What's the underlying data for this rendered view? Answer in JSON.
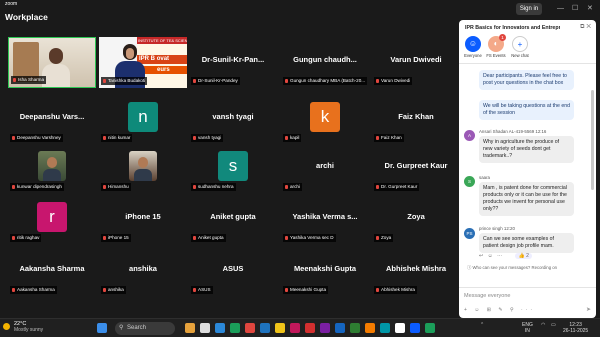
{
  "topbar": {
    "logo_small": "zoom",
    "logo_big": "Workplace",
    "signin": "Sign in",
    "minimize": "—",
    "maximize": "☐",
    "close": "✕"
  },
  "tiles": [
    {
      "name": "",
      "label": "Isha Sharma",
      "type": "video"
    },
    {
      "name": "",
      "label": "Tanishka Budakoti",
      "type": "video"
    },
    {
      "name": "Dr-Sunil-Kr-Pan...",
      "label": "Dr-Sunil-Kr-Pandey",
      "type": "text"
    },
    {
      "name": "Gungun  chaudh...",
      "label": "Gungun chaudhary MBA (Batch-20...",
      "type": "text"
    },
    {
      "name": "Varun Dwivedi",
      "label": "Varun Dwivedi",
      "type": "text"
    },
    {
      "name": "Deepanshu  Vars...",
      "label": "Deepanshu Varshney",
      "type": "text"
    },
    {
      "name": "",
      "label": "nitin kumar",
      "type": "avatar",
      "letter": "n",
      "color": "#0e8a7a"
    },
    {
      "name": "vansh tyagi",
      "label": "vansh tyagi",
      "type": "text"
    },
    {
      "name": "",
      "label": "kapil",
      "type": "avatar",
      "letter": "k",
      "color": "#e8711d"
    },
    {
      "name": "Faiz Khan",
      "label": "Faiz Khan",
      "type": "text"
    },
    {
      "name": "",
      "label": "kunwar dipendrasingh",
      "type": "photo"
    },
    {
      "name": "",
      "label": "Himanshu",
      "type": "photo2"
    },
    {
      "name": "",
      "label": "sudhanshu nehra",
      "type": "avatar",
      "letter": "s",
      "color": "#11897c"
    },
    {
      "name": "archi",
      "label": "archi",
      "type": "text"
    },
    {
      "name": "Dr. Gurpreet Kaur",
      "label": "Dr. Gurpreet Kaur",
      "type": "text"
    },
    {
      "name": "",
      "label": "ritik raghav",
      "type": "avatar",
      "letter": "r",
      "color": "#c8166e"
    },
    {
      "name": "iPhone 15",
      "label": "iPhone 15",
      "type": "text"
    },
    {
      "name": "Aniket gupta",
      "label": "Aniket gupta",
      "type": "text"
    },
    {
      "name": "Yashika  Verma  s...",
      "label": "Yashika Verma sec D",
      "type": "text"
    },
    {
      "name": "Zoya",
      "label": "Zoya",
      "type": "text"
    },
    {
      "name": "Aakansha Sharma",
      "label": "Aakansha Sharma",
      "type": "text"
    },
    {
      "name": "anshika",
      "label": "anshika",
      "type": "text"
    },
    {
      "name": "ASUS",
      "label": "ASUS",
      "type": "text"
    },
    {
      "name": "Meenakshi Gupta",
      "label": "Meenakshi Gupta",
      "type": "text"
    },
    {
      "name": "Abhishek Mishra",
      "label": "Abhishek Mishra",
      "type": "text"
    }
  ],
  "banner": {
    "line1": "INSTITUTE OF TE",
    "line2": "IPR B",
    "line3": "& SCIENC",
    "line4": "ovat",
    "line5": "eurs"
  },
  "chat": {
    "title": "IPR Basics for Innovators and Entrepren...",
    "tabs": [
      {
        "label": "Everyone"
      },
      {
        "label": "FS Events"
      },
      {
        "label": "New chat"
      }
    ],
    "badge": "1",
    "messages": [
      {
        "sender": "",
        "text": "Dear participants. Please feel free to post your questions in the chat box",
        "own": true
      },
      {
        "sender": "",
        "text": "We will be taking questions at the end of the session",
        "own": true
      },
      {
        "sender": "Ansari Shadan AL-419-5569  12:16",
        "text": "Why in agriculture the produce of new variety of seeds dont get trademark..?",
        "own": false
      },
      {
        "sender": "saara",
        "text": "Mam , is patent done for commercial products only or it can be use for the products we invent for personal use only??",
        "own": false
      },
      {
        "sender": "prince singh  12:20",
        "text": "Can we see some examples of patient design job profile mam.",
        "own": false
      }
    ],
    "reaction_count": "2",
    "visibility_note": "Who can see your messages? Recording on",
    "input_placeholder": "Message everyone",
    "tools": "+ ☺ ⊞ ✎ ⚲ ···"
  },
  "taskbar": {
    "temperature": "22°C",
    "weather": "Mostly sunny",
    "search_placeholder": "Search",
    "lang": "ENG",
    "region": "IN",
    "time": "12:23",
    "date": "26-11-2025"
  }
}
